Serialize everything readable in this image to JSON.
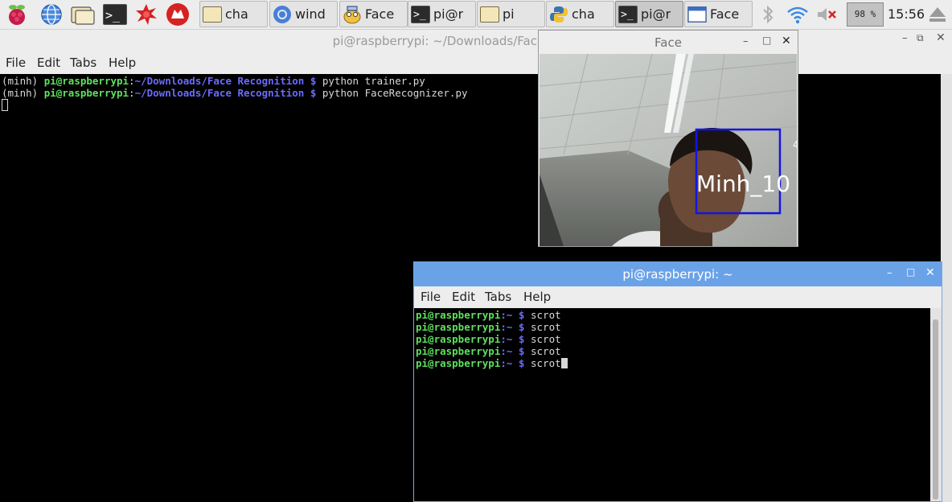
{
  "taskbar": {
    "tasks": [
      {
        "label": "cha",
        "icon": "folder-icon"
      },
      {
        "label": "wind",
        "icon": "chromium-icon"
      },
      {
        "label": "Face",
        "icon": "python-idle-icon"
      },
      {
        "label": "pi@r",
        "icon": "terminal-icon"
      },
      {
        "label": "pi",
        "icon": "folder-icon"
      },
      {
        "label": "cha",
        "icon": "python-icon"
      },
      {
        "label": "pi@r",
        "icon": "terminal-icon"
      },
      {
        "label": "Face",
        "icon": "window-icon"
      }
    ],
    "cpu": "98 %",
    "clock": "15:56"
  },
  "main_window": {
    "title": "pi@raspberrypi: ~/Downloads/Face Recognition",
    "menu": [
      "File",
      "Edit",
      "Tabs",
      "Help"
    ],
    "lines": [
      {
        "env": "(minh) ",
        "user": "pi@raspberrypi",
        "sep": ":",
        "path": "~/Downloads/Face Recognition $",
        "cmd": " python trainer.py"
      },
      {
        "env": "(minh) ",
        "user": "pi@raspberrypi",
        "sep": ":",
        "path": "~/Downloads/Face Recognition $",
        "cmd": " python FaceRecognizer.py"
      }
    ]
  },
  "face_window": {
    "title": "Face",
    "detected_label": "Minh_10"
  },
  "term2": {
    "title": "pi@raspberrypi: ~",
    "menu": [
      "File",
      "Edit",
      "Tabs",
      "Help"
    ],
    "prompt_user": "pi@raspberrypi",
    "prompt_rest": ":~ $",
    "commands": [
      "scrot",
      "scrot",
      "scrot",
      "scrot",
      "scrot"
    ]
  }
}
